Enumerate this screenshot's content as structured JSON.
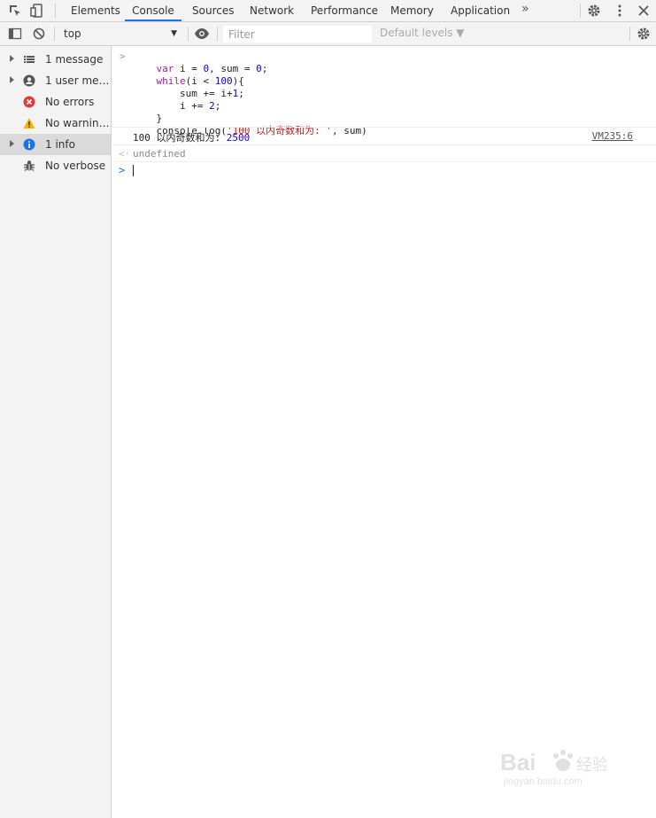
{
  "tabs": [
    "Elements",
    "Console",
    "Sources",
    "Network",
    "Performance",
    "Memory",
    "Application"
  ],
  "active_tab": "Console",
  "toolbar": {
    "context": "top",
    "filter_placeholder": "Filter",
    "levels": "Default levels ▼"
  },
  "sidebar": {
    "items": [
      {
        "label": "1 message",
        "icon": "list-icon",
        "expandable": true
      },
      {
        "label": "1 user mess...",
        "icon": "user-icon",
        "expandable": true
      },
      {
        "label": "No errors",
        "icon": "error-icon",
        "expandable": false
      },
      {
        "label": "No warnings",
        "icon": "warning-icon",
        "expandable": false
      },
      {
        "label": "1 info",
        "icon": "info-icon",
        "expandable": true,
        "selected": true
      },
      {
        "label": "No verbose",
        "icon": "bug-icon",
        "expandable": false
      }
    ]
  },
  "console": {
    "input_lines": [
      "var i = 0, sum = 0;",
      "while(i < 100){",
      "    sum += i+1;",
      "    i += 2;",
      "}",
      "console.log('100 以内奇数和为: ', sum)"
    ],
    "output_text": "100 以内奇数和为: ",
    "output_value": "2500",
    "source_link": "VM235:6",
    "return_value": "undefined"
  },
  "watermark": {
    "text": "Bai du 经验",
    "sub": "jingyan.baidu.com"
  },
  "colors": {
    "accent": "#1a73e8",
    "error": "#e53935",
    "warning": "#f4b400",
    "info": "#1a73e8"
  }
}
